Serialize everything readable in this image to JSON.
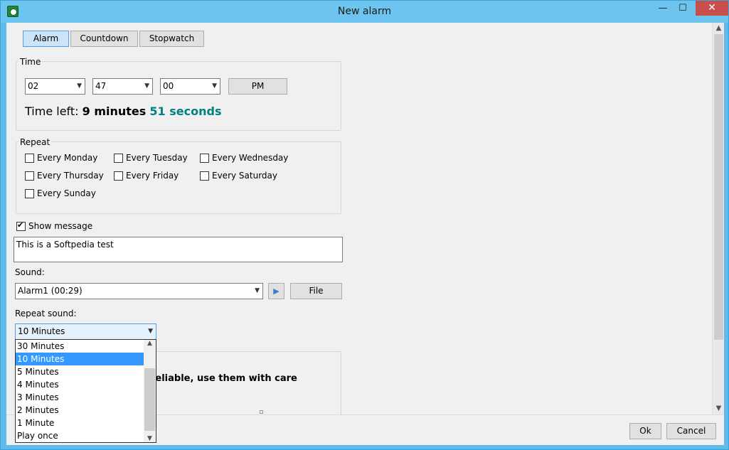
{
  "window": {
    "title": "New alarm",
    "minimize_glyph": "—",
    "maximize_glyph": "☐",
    "close_glyph": "✕",
    "icon": "alarm-clock-icon"
  },
  "mode_tabs": [
    {
      "label": "Alarm",
      "active": true
    },
    {
      "label": "Countdown",
      "active": false
    },
    {
      "label": "Stopwatch",
      "active": false
    }
  ],
  "time_group": {
    "label": "Time",
    "hour": "02",
    "minute": "47",
    "second": "00",
    "ampm_label": "PM",
    "time_left_prefix": "Time left:",
    "time_left_minutes": "9 minutes",
    "time_left_seconds": "51 seconds",
    "seconds_color": "#008080"
  },
  "repeat_group": {
    "label": "Repeat",
    "days": [
      {
        "label": "Every Monday",
        "checked": false
      },
      {
        "label": "Every Tuesday",
        "checked": false
      },
      {
        "label": "Every Wednesday",
        "checked": false
      },
      {
        "label": "Every Thursday",
        "checked": false
      },
      {
        "label": "Every Friday",
        "checked": false
      },
      {
        "label": "Every Saturday",
        "checked": false
      },
      {
        "label": "Every Sunday",
        "checked": false
      }
    ]
  },
  "show_message": {
    "label": "Show message",
    "checked": true,
    "text": "This is a Softpedia test"
  },
  "sound": {
    "label": "Sound:",
    "value": "Alarm1 (00:29)",
    "play_icon": "play-icon",
    "file_label": "File"
  },
  "repeat_sound": {
    "label": "Repeat sound:",
    "value": "10 Minutes",
    "options": [
      {
        "label": "30 Minutes",
        "selected": false
      },
      {
        "label": "10 Minutes",
        "selected": true
      },
      {
        "label": "5 Minutes",
        "selected": false
      },
      {
        "label": "4 Minutes",
        "selected": false
      },
      {
        "label": "3 Minutes",
        "selected": false
      },
      {
        "label": "2 Minutes",
        "selected": false
      },
      {
        "label": "1 Minute",
        "selected": false
      },
      {
        "label": "Play once",
        "selected": false
      }
    ]
  },
  "warning": {
    "text": "reliable, use them with care"
  },
  "footer": {
    "ok_label": "Ok",
    "cancel_label": "Cancel"
  },
  "colors": {
    "title_bar": "#6cc4ef",
    "close_button": "#c7504b",
    "active_tab": "#cce4f7",
    "selection": "#3399ff"
  }
}
